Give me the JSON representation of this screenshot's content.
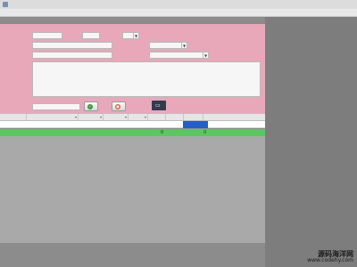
{
  "window": {
    "title": ""
  },
  "menu": {
    "items": [
      {
        "label": ""
      },
      {
        "label": ""
      },
      {
        "label": ""
      },
      {
        "label": ""
      },
      {
        "label": ""
      }
    ]
  },
  "form": {
    "customer_label": "",
    "customer_value": "",
    "age_label": "",
    "age_value": "",
    "gender_label": "",
    "gender_value": "",
    "id_label": "",
    "id_value": "",
    "idcard_label": "",
    "idcard_value": "",
    "birth_label": "",
    "birth_value": "",
    "phone_label": "",
    "phone_value": "",
    "created_label": "",
    "created_value": "",
    "address_label": "",
    "address_value": "",
    "amount_label": "",
    "amount_value": ""
  },
  "buttons": {
    "save_label": "",
    "print_label": "",
    "confirm_label": ""
  },
  "grid": {
    "columns": [
      {
        "label": ""
      },
      {
        "label": ""
      },
      {
        "label": ""
      },
      {
        "label": ""
      },
      {
        "label": ""
      },
      {
        "label": ""
      },
      {
        "label": ""
      },
      {
        "label": ""
      }
    ],
    "total_row": {
      "label": "",
      "qty": "0",
      "amount": "0"
    }
  },
  "watermark": {
    "line1": "源码海洋网",
    "line2": "www.codehy.com"
  },
  "colors": {
    "form_bg": "#e8a8ba",
    "total_row": "#58c95d",
    "selected_cell": "#1f5fd0",
    "confirm_button": "#2e3d52"
  }
}
